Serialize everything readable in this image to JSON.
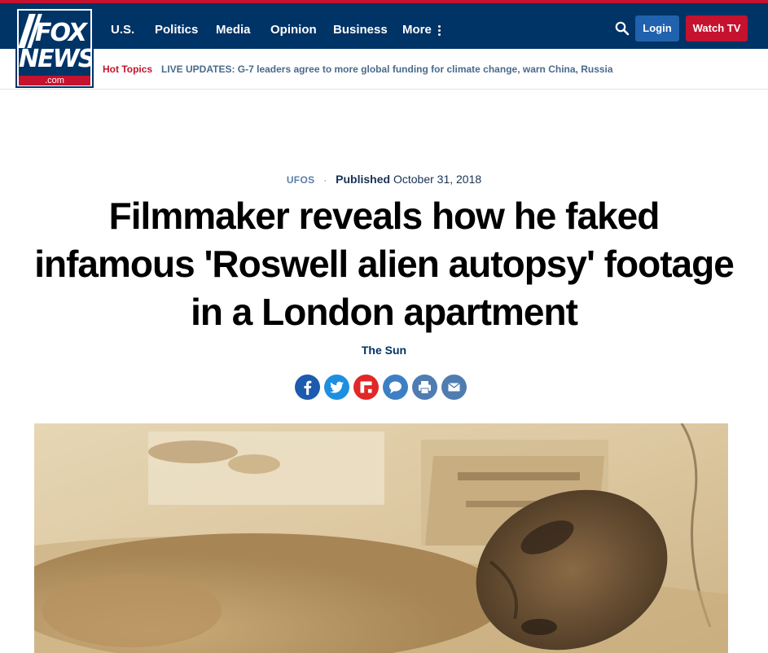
{
  "brand": {
    "logo_line1": "FOX",
    "logo_line2": "NEWS",
    "logo_domain": ".com"
  },
  "nav": {
    "items": [
      {
        "label": "U.S."
      },
      {
        "label": "Politics"
      },
      {
        "label": "Media"
      },
      {
        "label": "Opinion"
      },
      {
        "label": "Business"
      },
      {
        "label": "More"
      }
    ],
    "search_icon": "search-icon",
    "login_label": "Login",
    "watch_label": "Watch TV"
  },
  "hot_topics": {
    "label": "Hot Topics",
    "link": "LIVE UPDATES: G-7 leaders agree to more global funding for climate change, warn China, Russia"
  },
  "article": {
    "category": "UFOS",
    "separator": "·",
    "published_label": "Published",
    "published_date": "October 31, 2018",
    "headline": "Filmmaker reveals how he faked infamous 'Roswell alien autopsy' footage in a London apartment",
    "author": "The Sun"
  },
  "share": [
    {
      "name": "facebook-icon",
      "color": "#1c5bad"
    },
    {
      "name": "twitter-icon",
      "color": "#1d8fe0"
    },
    {
      "name": "flipboard-icon",
      "color": "#e12828"
    },
    {
      "name": "comment-icon",
      "color": "#3d7fc4"
    },
    {
      "name": "print-icon",
      "color": "#4f7db1"
    },
    {
      "name": "email-icon",
      "color": "#4f7db1"
    }
  ],
  "colors": {
    "navy": "#003366",
    "red": "#c5122e",
    "login_blue": "#2062ad"
  }
}
